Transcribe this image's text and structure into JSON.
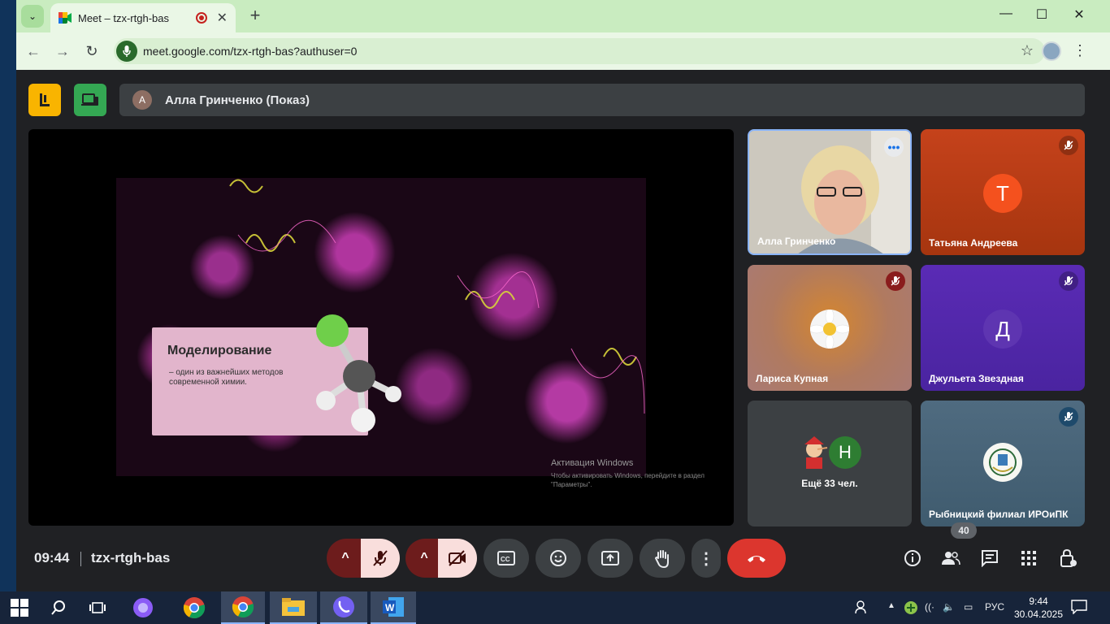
{
  "browser": {
    "tab_title": "Meet – tzx-rtgh-bas",
    "url": "meet.google.com/tzx-rtgh-bas?authuser=0"
  },
  "meet": {
    "presenter": {
      "avatar_letter": "А",
      "label": "Алла Гринченко (Показ)"
    },
    "slide": {
      "title": "Моделирование",
      "subtitle": "– один из важнейших методов современной химии."
    },
    "watermark": {
      "title": "Активация Windows",
      "sub": "Чтобы активировать Windows, перейдите в раздел \"Параметры\"."
    },
    "tiles": [
      {
        "name": "Алла Гринченко"
      },
      {
        "name": "Татьяна Андреева",
        "avatar_letter": "Т"
      },
      {
        "name": "Лариса Купная"
      },
      {
        "name": "Джульета Звездная",
        "avatar_letter": "Д"
      },
      {
        "name": "Ещё 33 чел.",
        "avatar_letter": "Н"
      },
      {
        "name": "Рыбницкий филиал ИРОиПК"
      }
    ],
    "controls": {
      "time": "09:44",
      "meeting_code": "tzx-rtgh-bas",
      "people_count": "40"
    }
  },
  "taskbar": {
    "language": "РУС",
    "time": "9:44",
    "date": "30.04.2025"
  },
  "colors": {
    "tab_bar": "#c9ecc0",
    "end_call": "#dc362e",
    "muted_bg": "#f9dedc",
    "accent_yellow": "#f9b400",
    "accent_green": "#34a853"
  }
}
